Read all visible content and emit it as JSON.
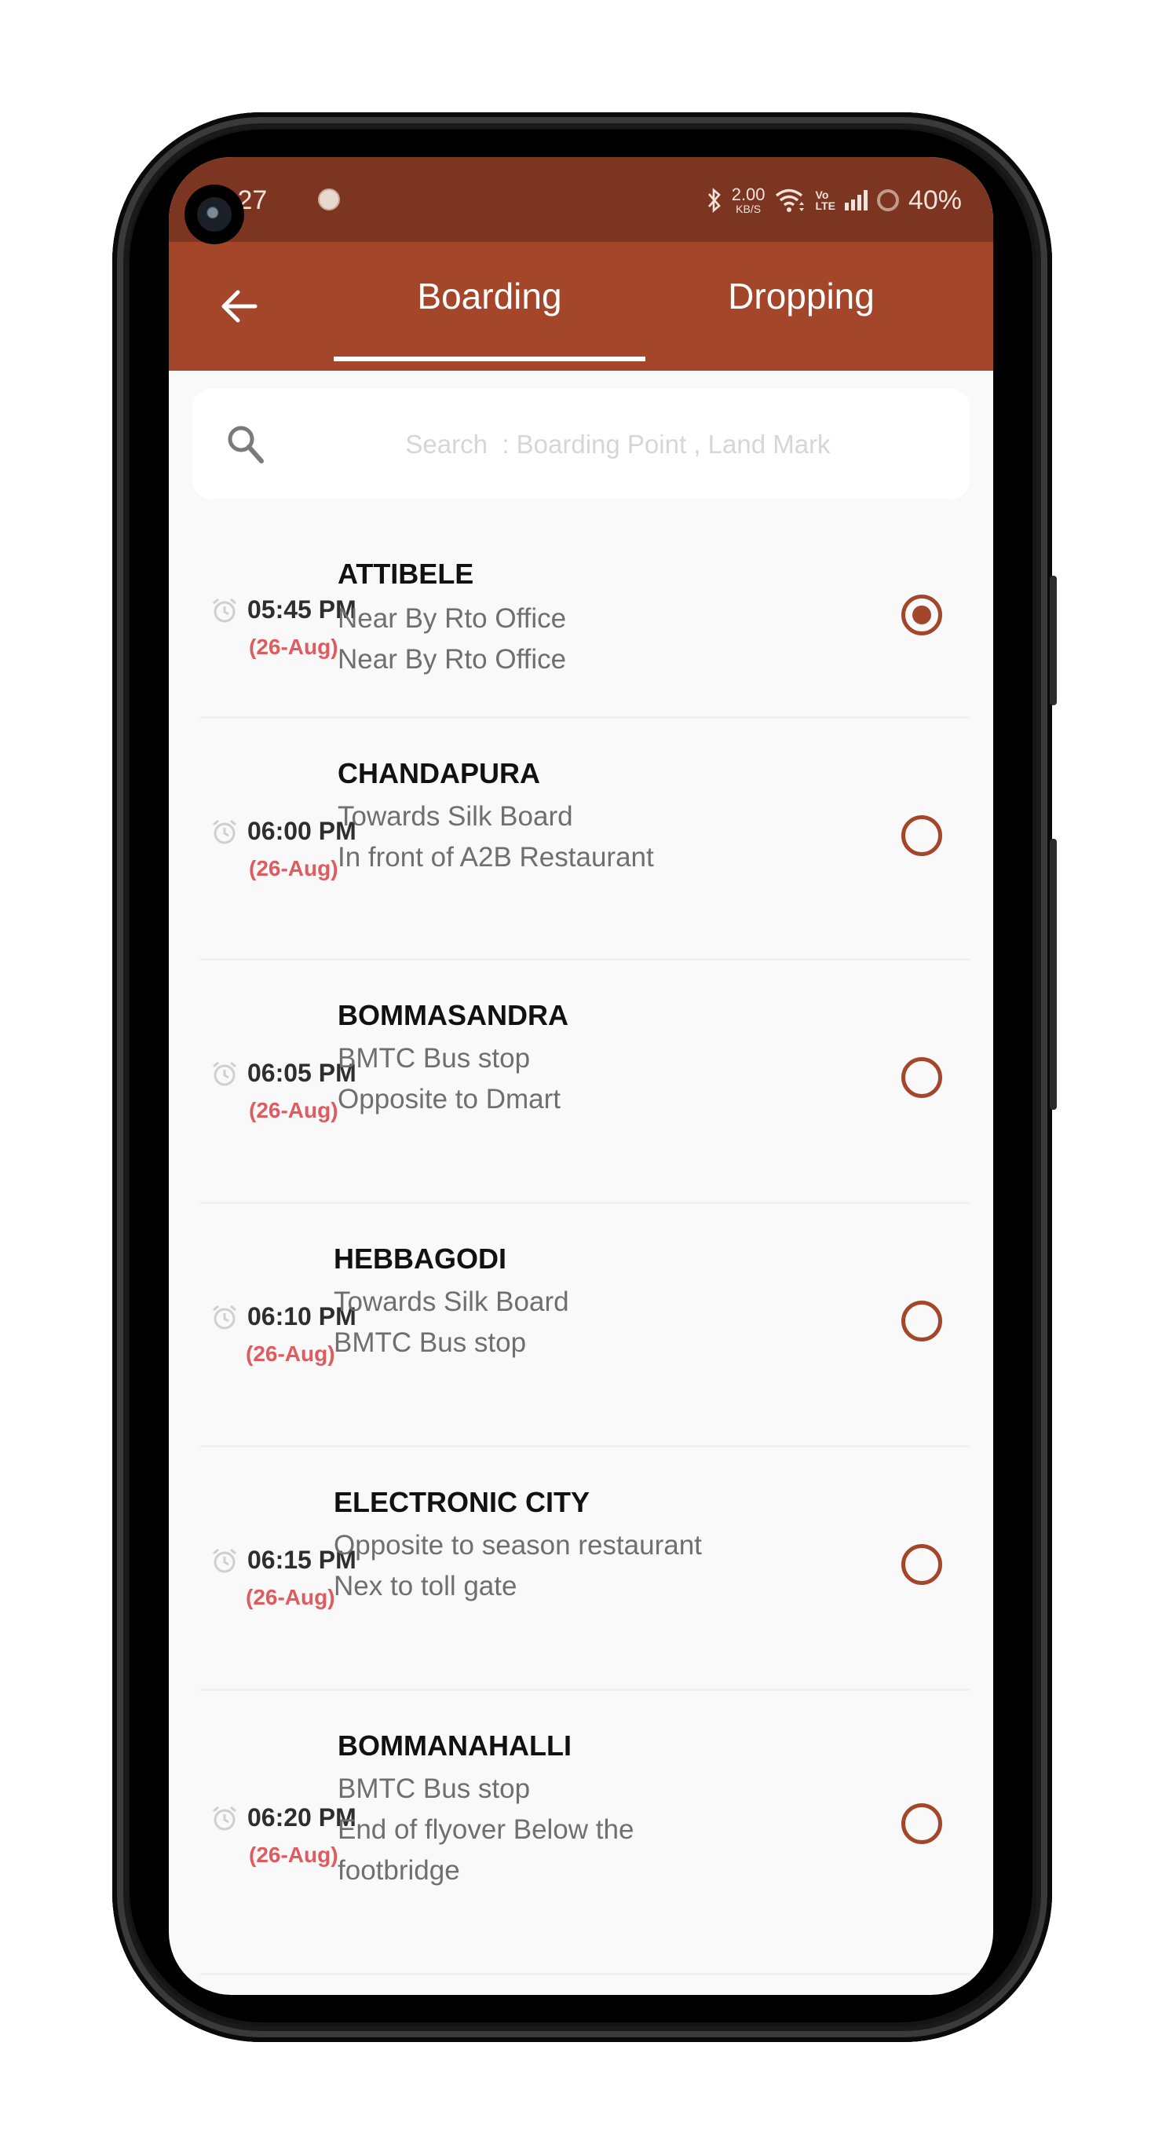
{
  "status_bar": {
    "time": ":27",
    "network_speed_value": "2.00",
    "network_speed_unit": "KB/S",
    "volte_top": "Vo",
    "volte_bottom": "LTE",
    "battery": "40%",
    "icons": [
      "notification-app-icon",
      "bluetooth-icon",
      "wifi-icon",
      "volte-icon",
      "signal-icon",
      "battery-icon"
    ]
  },
  "header": {
    "back_icon": "arrow-left-icon",
    "tabs": [
      {
        "label": "Boarding",
        "active": true
      },
      {
        "label": "Dropping",
        "active": false
      }
    ]
  },
  "search": {
    "icon": "search-icon",
    "value": "",
    "placeholder": "Search  : Boarding Point , Land Mark"
  },
  "colors": {
    "status_bar": "#7c3520",
    "header": "#a3462a",
    "accent": "#a3462a",
    "date": "#e05a5e",
    "background": "#f9f9f9"
  },
  "boarding_points": [
    {
      "time": "05:45 PM",
      "date": "(26-Aug)",
      "name": "ATTIBELE",
      "lines": [
        "Near By Rto Office",
        "Near By Rto Office"
      ],
      "selected": true
    },
    {
      "time": "06:00 PM",
      "date": "(26-Aug)",
      "name": "CHANDAPURA",
      "lines": [
        "Towards Silk Board",
        "In front of A2B Restaurant"
      ],
      "selected": false
    },
    {
      "time": "06:05 PM",
      "date": "(26-Aug)",
      "name": "BOMMASANDRA",
      "lines": [
        "BMTC Bus stop",
        "Opposite to Dmart"
      ],
      "selected": false
    },
    {
      "time": "06:10 PM",
      "date": "(26-Aug)",
      "name": "HEBBAGODI",
      "lines": [
        "Towards Silk Board",
        "BMTC Bus stop"
      ],
      "selected": false
    },
    {
      "time": "06:15 PM",
      "date": "(26-Aug)",
      "name": "ELECTRONIC CITY",
      "lines": [
        "Opposite to season restaurant",
        "Nex to toll gate"
      ],
      "selected": false
    },
    {
      "time": "06:20 PM",
      "date": "(26-Aug)",
      "name": "BOMMANAHALLI",
      "lines": [
        "BMTC Bus stop",
        "End of flyover Below the",
        "footbridge"
      ],
      "selected": false
    }
  ]
}
